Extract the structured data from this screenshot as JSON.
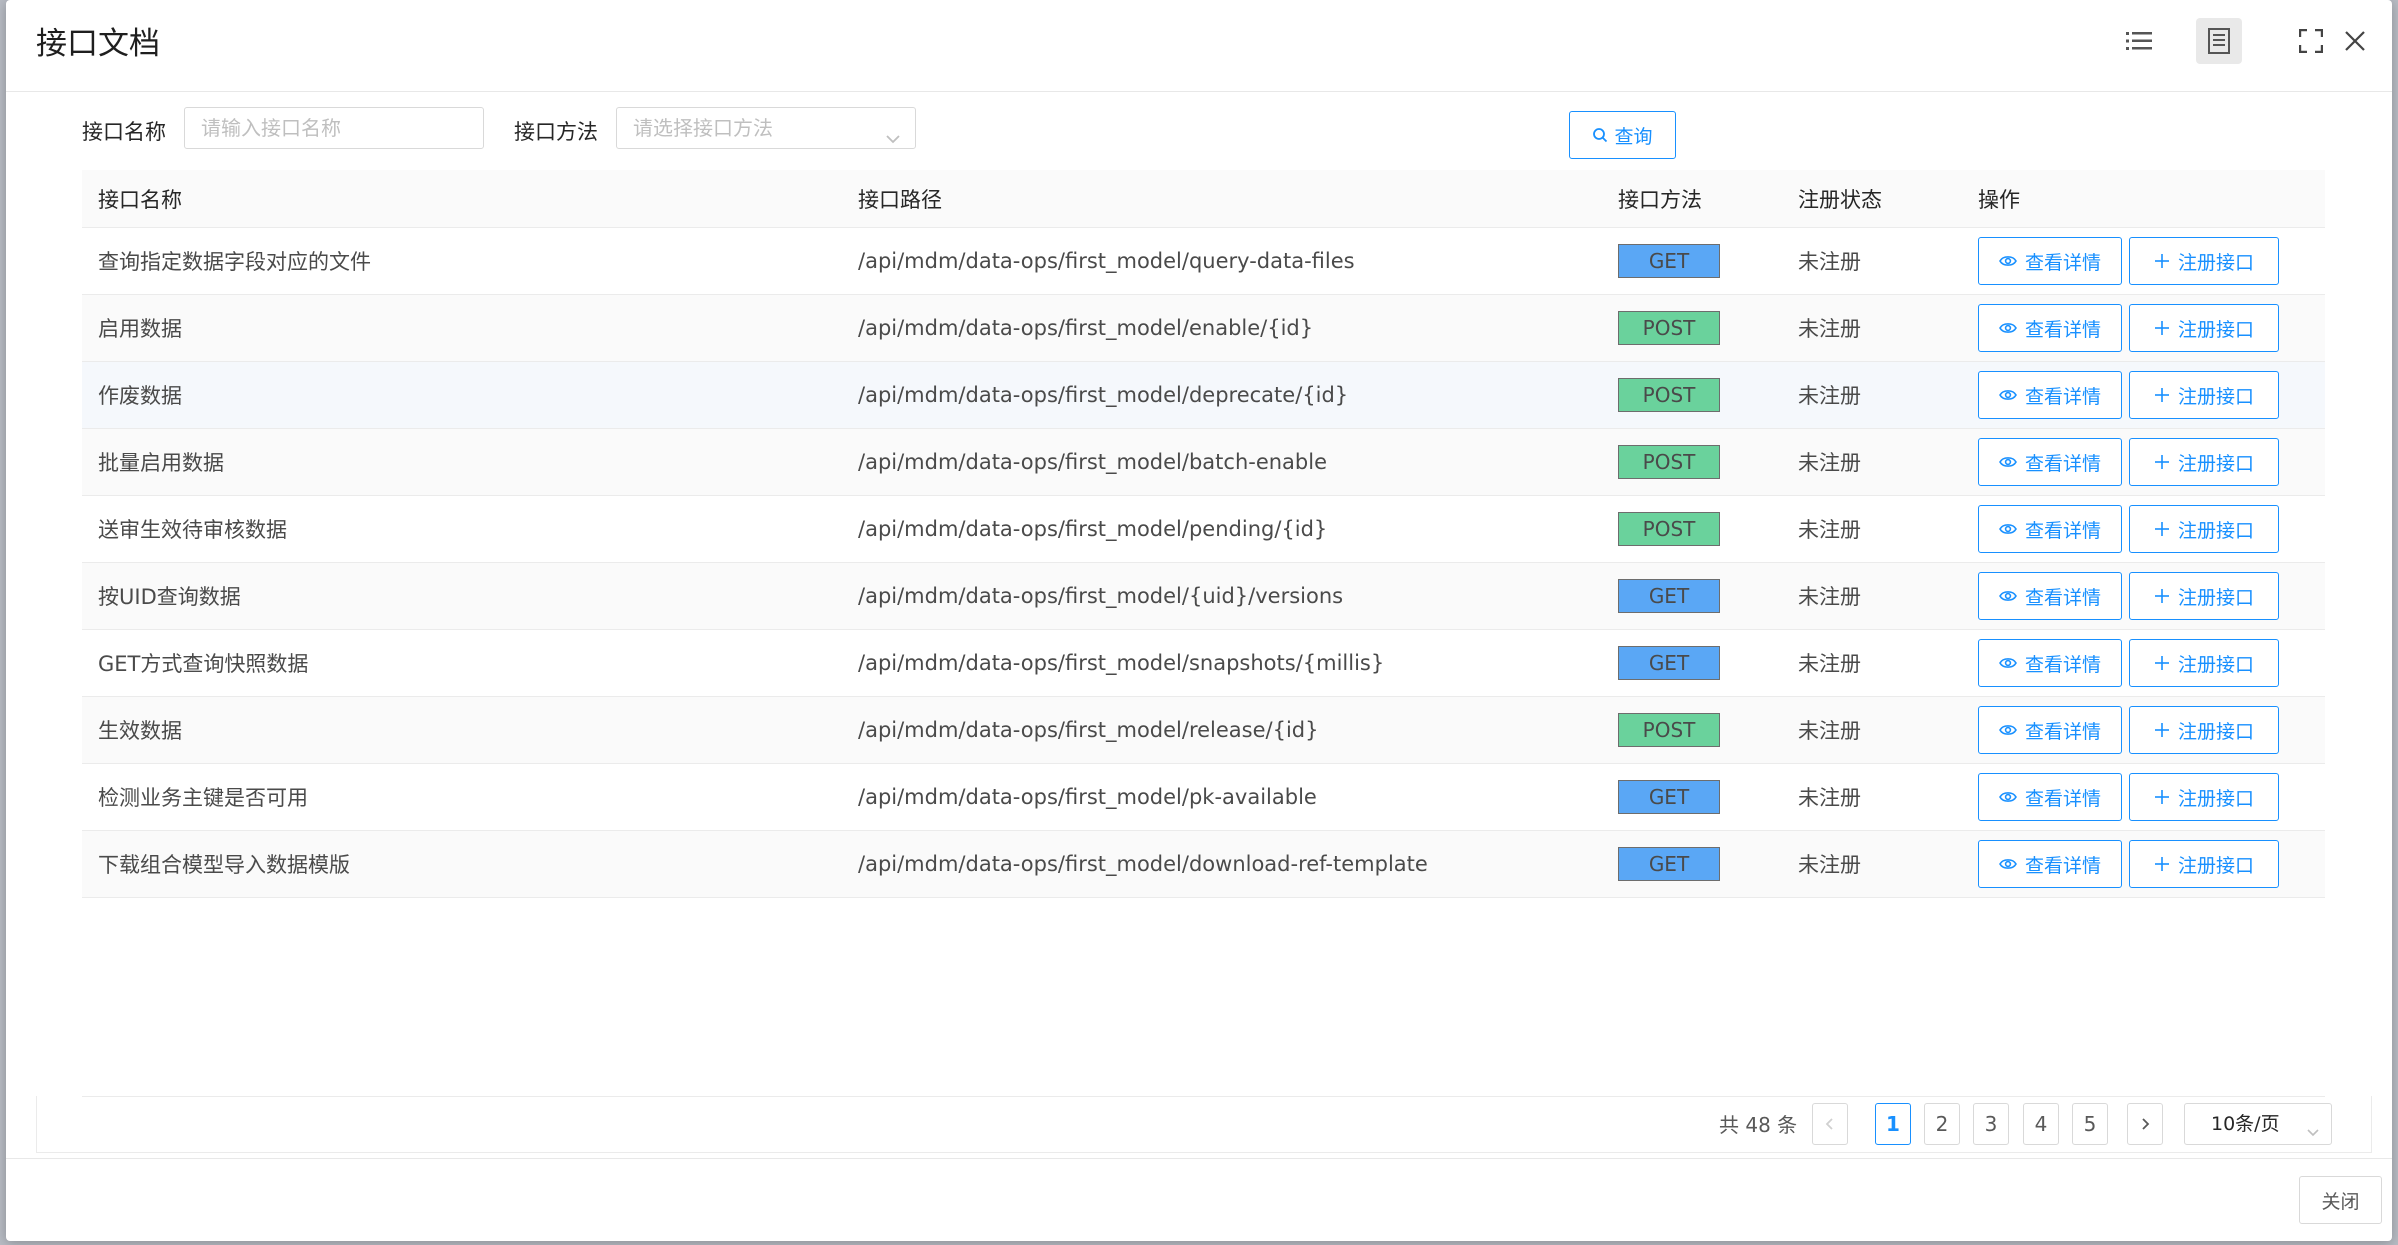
{
  "modal": {
    "title": "接口文档"
  },
  "filters": {
    "name_label": "接口名称",
    "name_placeholder": "请输入接口名称",
    "method_label": "接口方法",
    "method_placeholder": "请选择接口方法",
    "query_label": "查询"
  },
  "table": {
    "headers": [
      "接口名称",
      "接口路径",
      "接口方法",
      "注册状态",
      "操作"
    ],
    "rows": [
      {
        "name": "查询指定数据字段对应的文件",
        "path": "/api/mdm/data-ops/first_model/query-data-files",
        "method": "GET",
        "status": "未注册"
      },
      {
        "name": "启用数据",
        "path": "/api/mdm/data-ops/first_model/enable/{id}",
        "method": "POST",
        "status": "未注册"
      },
      {
        "name": "作废数据",
        "path": "/api/mdm/data-ops/first_model/deprecate/{id}",
        "method": "POST",
        "status": "未注册"
      },
      {
        "name": "批量启用数据",
        "path": "/api/mdm/data-ops/first_model/batch-enable",
        "method": "POST",
        "status": "未注册"
      },
      {
        "name": "送审生效待审核数据",
        "path": "/api/mdm/data-ops/first_model/pending/{id}",
        "method": "POST",
        "status": "未注册"
      },
      {
        "name": "按UID查询数据",
        "path": "/api/mdm/data-ops/first_model/{uid}/versions",
        "method": "GET",
        "status": "未注册"
      },
      {
        "name": "GET方式查询快照数据",
        "path": "/api/mdm/data-ops/first_model/snapshots/{millis}",
        "method": "GET",
        "status": "未注册"
      },
      {
        "name": "生效数据",
        "path": "/api/mdm/data-ops/first_model/release/{id}",
        "method": "POST",
        "status": "未注册"
      },
      {
        "name": "检测业务主键是否可用",
        "path": "/api/mdm/data-ops/first_model/pk-available",
        "method": "GET",
        "status": "未注册"
      },
      {
        "name": "下载组合模型导入数据模版",
        "path": "/api/mdm/data-ops/first_model/download-ref-template",
        "method": "GET",
        "status": "未注册"
      }
    ],
    "action_view": "查看详情",
    "action_register": "注册接口"
  },
  "pagination": {
    "total_text": "共 48 条",
    "pages": [
      "1",
      "2",
      "3",
      "4",
      "5"
    ],
    "current": "1",
    "page_size": "10条/页"
  },
  "footer": {
    "close_label": "关闭"
  },
  "colors": {
    "accent": "#1890ff",
    "get": "#5aa7f5",
    "post": "#6ad29c"
  }
}
